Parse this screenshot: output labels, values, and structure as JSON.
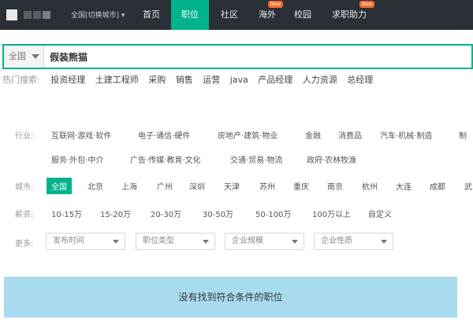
{
  "header": {
    "city_switch": "全国[切换城市] ▾",
    "nav": [
      {
        "label": "首页"
      },
      {
        "label": "职位"
      },
      {
        "label": "社区"
      },
      {
        "label": "海外",
        "badge": "New"
      },
      {
        "label": "校园"
      },
      {
        "label": "求职助力",
        "badge": "New"
      }
    ]
  },
  "search": {
    "scope": "全国",
    "query": "假装熊猫"
  },
  "hot": {
    "label": "热门搜索:",
    "terms": [
      "投资经理",
      "土建工程师",
      "采购",
      "销售",
      "运营",
      "java",
      "产品经理",
      "人力资源",
      "总经理"
    ]
  },
  "filters": {
    "industry": {
      "label": "行业:",
      "row1": [
        "互联网·游戏·软件",
        "电子·通信·硬件",
        "房地产·建筑·物业",
        "金融",
        "消费品",
        "汽车·机械·制造",
        "制"
      ],
      "row2": [
        "服务·外包·中介",
        "广告·传媒·教育·文化",
        "交通·贸易·物流",
        "政府·农林牧渔"
      ]
    },
    "city": {
      "label": "城市:",
      "options": [
        "全国",
        "北京",
        "上海",
        "广州",
        "深圳",
        "天津",
        "苏州",
        "重庆",
        "南京",
        "杭州",
        "大连",
        "成都",
        "武"
      ]
    },
    "salary": {
      "label": "薪资:",
      "options": [
        "10-15万",
        "15-20万",
        "20-30万",
        "30-50万",
        "50-100万",
        "100万以上",
        "自定义"
      ]
    },
    "more": {
      "label": "更多:",
      "dropdowns": [
        "发布时间",
        "职位类型",
        "企业规模",
        "企业性质"
      ]
    }
  },
  "result": {
    "empty_message": "没有找到符合条件的职位"
  },
  "colors": {
    "accent": "#00b38a",
    "nav_bg": "#2b2f36",
    "empty_bg": "#a9dbee"
  }
}
